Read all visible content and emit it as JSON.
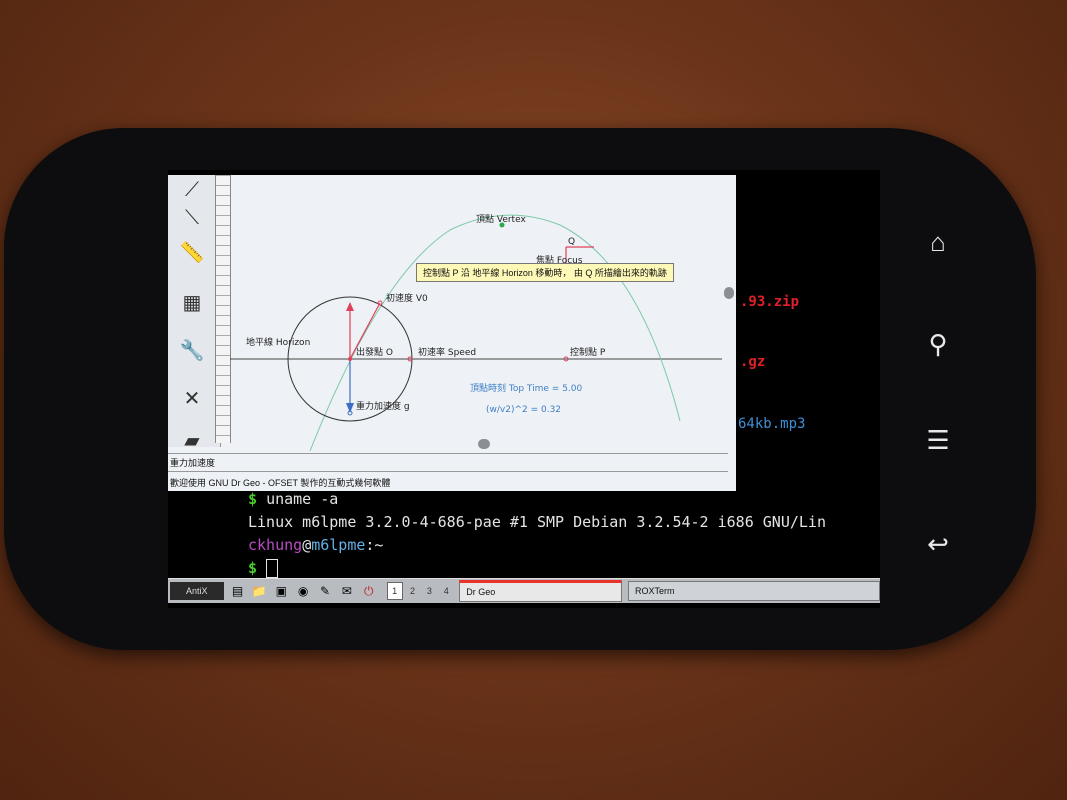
{
  "terminal": {
    "prompt_symbol": "$",
    "command": "uname -a",
    "output": "Linux m6lpme 3.2.0-4-686-pae #1 SMP Debian 3.2.54-2 i686 GNU/Lin",
    "user": "ckhung",
    "at": "@",
    "host": "m6lpme",
    "path": ":~",
    "background_files": [
      ".93.zip",
      ".gz",
      "64kb.mp3"
    ]
  },
  "drgeo": {
    "labels": {
      "vertex": "頂點 Vertex",
      "q": "Q",
      "focus": "焦點 Focus",
      "v0": "初速度 V0",
      "horizon": "地平線 Horizon",
      "origin": "出發點 O",
      "speed": "初速率 Speed",
      "p": "控制點 P",
      "toptime": "頂點時刻 Top Time = 5.00",
      "ratio": "(w/v2)^2 = 0.32",
      "gravity": "重力加速度 g"
    },
    "tooltip": "控制點 P 沿 地平線 Horizon 移動時， 由 Q 所描繪出來的軌跡",
    "status_tool": "重力加速度",
    "status_welcome": "歡迎使用 GNU Dr Geo - OFSET 製作的互動式幾何軟體"
  },
  "taskbar": {
    "start": "AntiX",
    "workspaces": [
      "1",
      "2",
      "3",
      "4"
    ],
    "active_workspace": "1",
    "tasks": [
      "Dr Geo",
      "ROXTerm"
    ]
  },
  "colors": {
    "prompt_green": "#4ccb2c",
    "user_purple": "#b94cc4",
    "host_blue": "#63b0e6",
    "file_red": "#e0202a",
    "parabola": "#7ec8a8",
    "vector_red": "#e0405a"
  }
}
